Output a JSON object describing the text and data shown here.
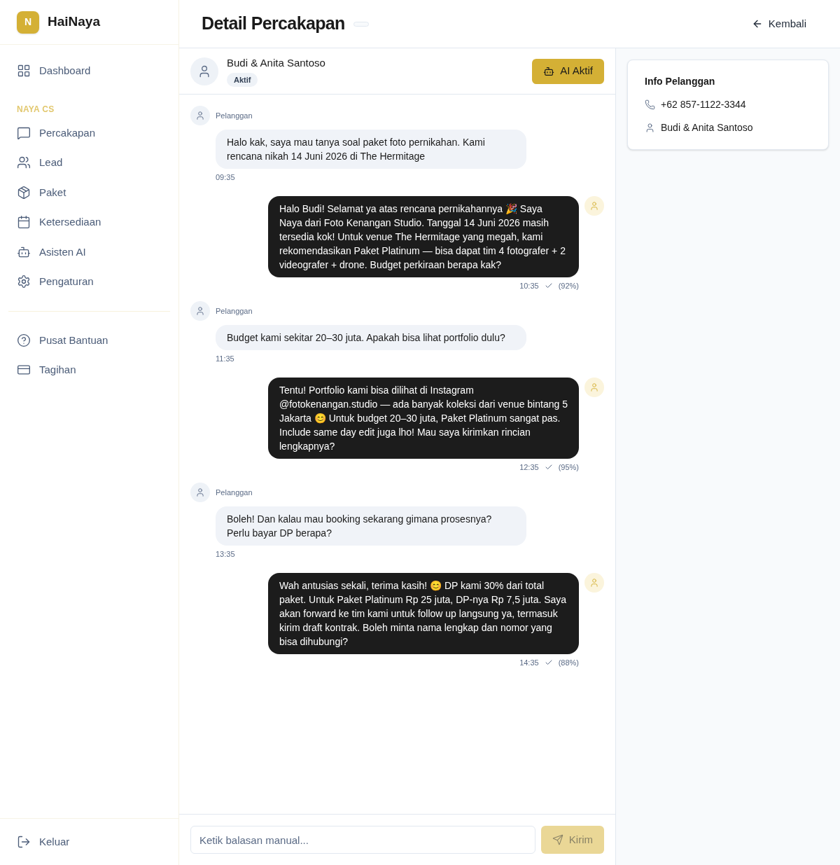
{
  "sidebar": {
    "logo_letter": "N",
    "brand": "HaiNaya",
    "top_items": [
      {
        "label": "Dashboard",
        "selected": false
      }
    ],
    "section_label": "NAYA CS",
    "items": [
      {
        "label": "Percakapan",
        "selected": false
      },
      {
        "label": "Lead",
        "selected": false
      },
      {
        "label": "Paket",
        "selected": false
      },
      {
        "label": "Ketersediaan",
        "selected": false
      },
      {
        "label": "Asisten AI",
        "selected": false
      },
      {
        "label": "Pengaturan",
        "selected": false
      }
    ],
    "bottom_items": [
      {
        "label": "Pusat Bantuan",
        "selected": false
      },
      {
        "label": "Tagihan",
        "selected": false
      }
    ],
    "logout": "Keluar"
  },
  "header": {
    "title": "Detail Percakapan",
    "back": "Kembali"
  },
  "contact": {
    "name": "Budi & Anita Santoso",
    "status": "Aktif",
    "ai_button": "AI Aktif"
  },
  "messages": [
    {
      "kind": "customer",
      "sender": "Pelanggan",
      "text": "Halo kak, saya mau tanya soal paket foto pernikahan. Kami rencana nikah 14 Juni 2026 di The Hermitage",
      "time": "09:35"
    },
    {
      "kind": "ai",
      "text": "Halo Budi! Selamat ya atas rencana pernikahannya 🎉 Saya Naya dari Foto Kenangan Studio. Tanggal 14 Juni 2026 masih tersedia kok! Untuk venue The Hermitage yang megah, kami rekomendasikan Paket Platinum — bisa dapat tim 4 fotografer + 2 videografer + drone. Budget perkiraan berapa kak?",
      "time": "10:35",
      "confidence": "(92%)"
    },
    {
      "kind": "customer",
      "sender": "Pelanggan",
      "text": "Budget kami sekitar 20–30 juta. Apakah bisa lihat portfolio dulu?",
      "time": "11:35"
    },
    {
      "kind": "ai",
      "text": "Tentu! Portfolio kami bisa dilihat di Instagram @fotokenangan.studio — ada banyak koleksi dari venue bintang 5 Jakarta 😊 Untuk budget 20–30 juta, Paket Platinum sangat pas. Include same day edit juga lho! Mau saya kirimkan rincian lengkapnya?",
      "time": "12:35",
      "confidence": "(95%)"
    },
    {
      "kind": "customer",
      "sender": "Pelanggan",
      "text": "Boleh! Dan kalau mau booking sekarang gimana prosesnya? Perlu bayar DP berapa?",
      "time": "13:35"
    },
    {
      "kind": "ai",
      "text": "Wah antusias sekali, terima kasih! 😊 DP kami 30% dari total paket. Untuk Paket Platinum Rp 25 juta, DP-nya Rp 7,5 juta. Saya akan forward ke tim kami untuk follow up langsung ya, termasuk kirim draft kontrak. Boleh minta nama lengkap dan nomor yang bisa dihubungi?",
      "time": "14:35",
      "confidence": "(88%)"
    }
  ],
  "composer": {
    "placeholder": "Ketik balasan manual...",
    "send": "Kirim",
    "disabled": true
  },
  "info": {
    "title": "Info Pelanggan",
    "phone": "+62 857-1122-3344",
    "name": "Budi & Anita Santoso"
  }
}
